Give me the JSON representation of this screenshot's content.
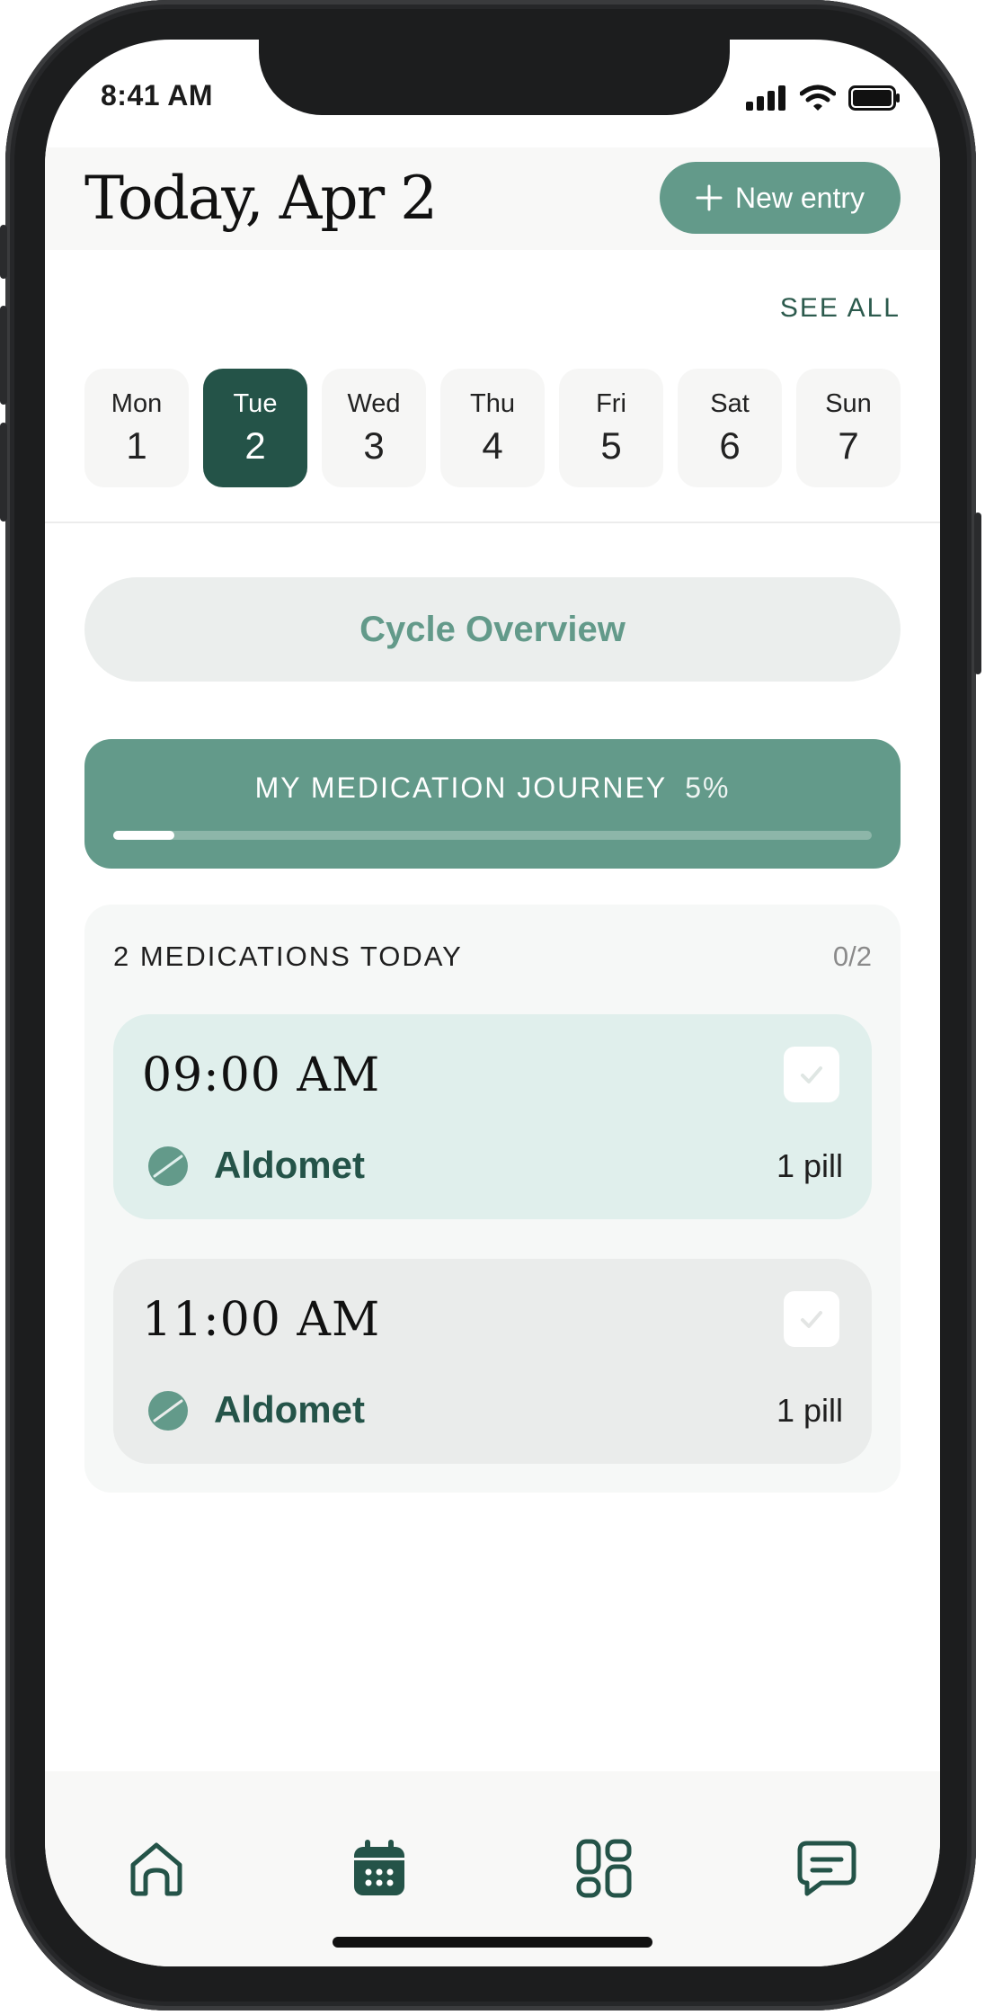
{
  "status_bar": {
    "time": "8:41 AM"
  },
  "header": {
    "title": "Today, Apr 2",
    "new_entry_label": "New entry"
  },
  "week": {
    "see_all_label": "SEE ALL",
    "days": [
      {
        "name": "Mon",
        "date": "1"
      },
      {
        "name": "Tue",
        "date": "2",
        "selected": true
      },
      {
        "name": "Wed",
        "date": "3"
      },
      {
        "name": "Thu",
        "date": "4"
      },
      {
        "name": "Fri",
        "date": "5"
      },
      {
        "name": "Sat",
        "date": "6"
      },
      {
        "name": "Sun",
        "date": "7"
      }
    ]
  },
  "cycle_overview": {
    "label": "Cycle Overview"
  },
  "journey": {
    "label": "MY MEDICATION JOURNEY",
    "percent_text": "5%",
    "progress": 0.05
  },
  "medications": {
    "title": "2 MEDICATIONS TODAY",
    "count": "0/2",
    "doses": [
      {
        "time": "09:00 AM",
        "name": "Aldomet",
        "amount": "1 pill"
      },
      {
        "time": "11:00 AM",
        "name": "Aldomet",
        "amount": "1 pill"
      }
    ]
  },
  "tab_bar": {
    "items": [
      "home-icon",
      "calendar-icon",
      "grid-icon",
      "chat-icon"
    ]
  },
  "colors": {
    "accent": "#639a8a",
    "dark": "#245348",
    "surface": "#f6f8f7"
  }
}
